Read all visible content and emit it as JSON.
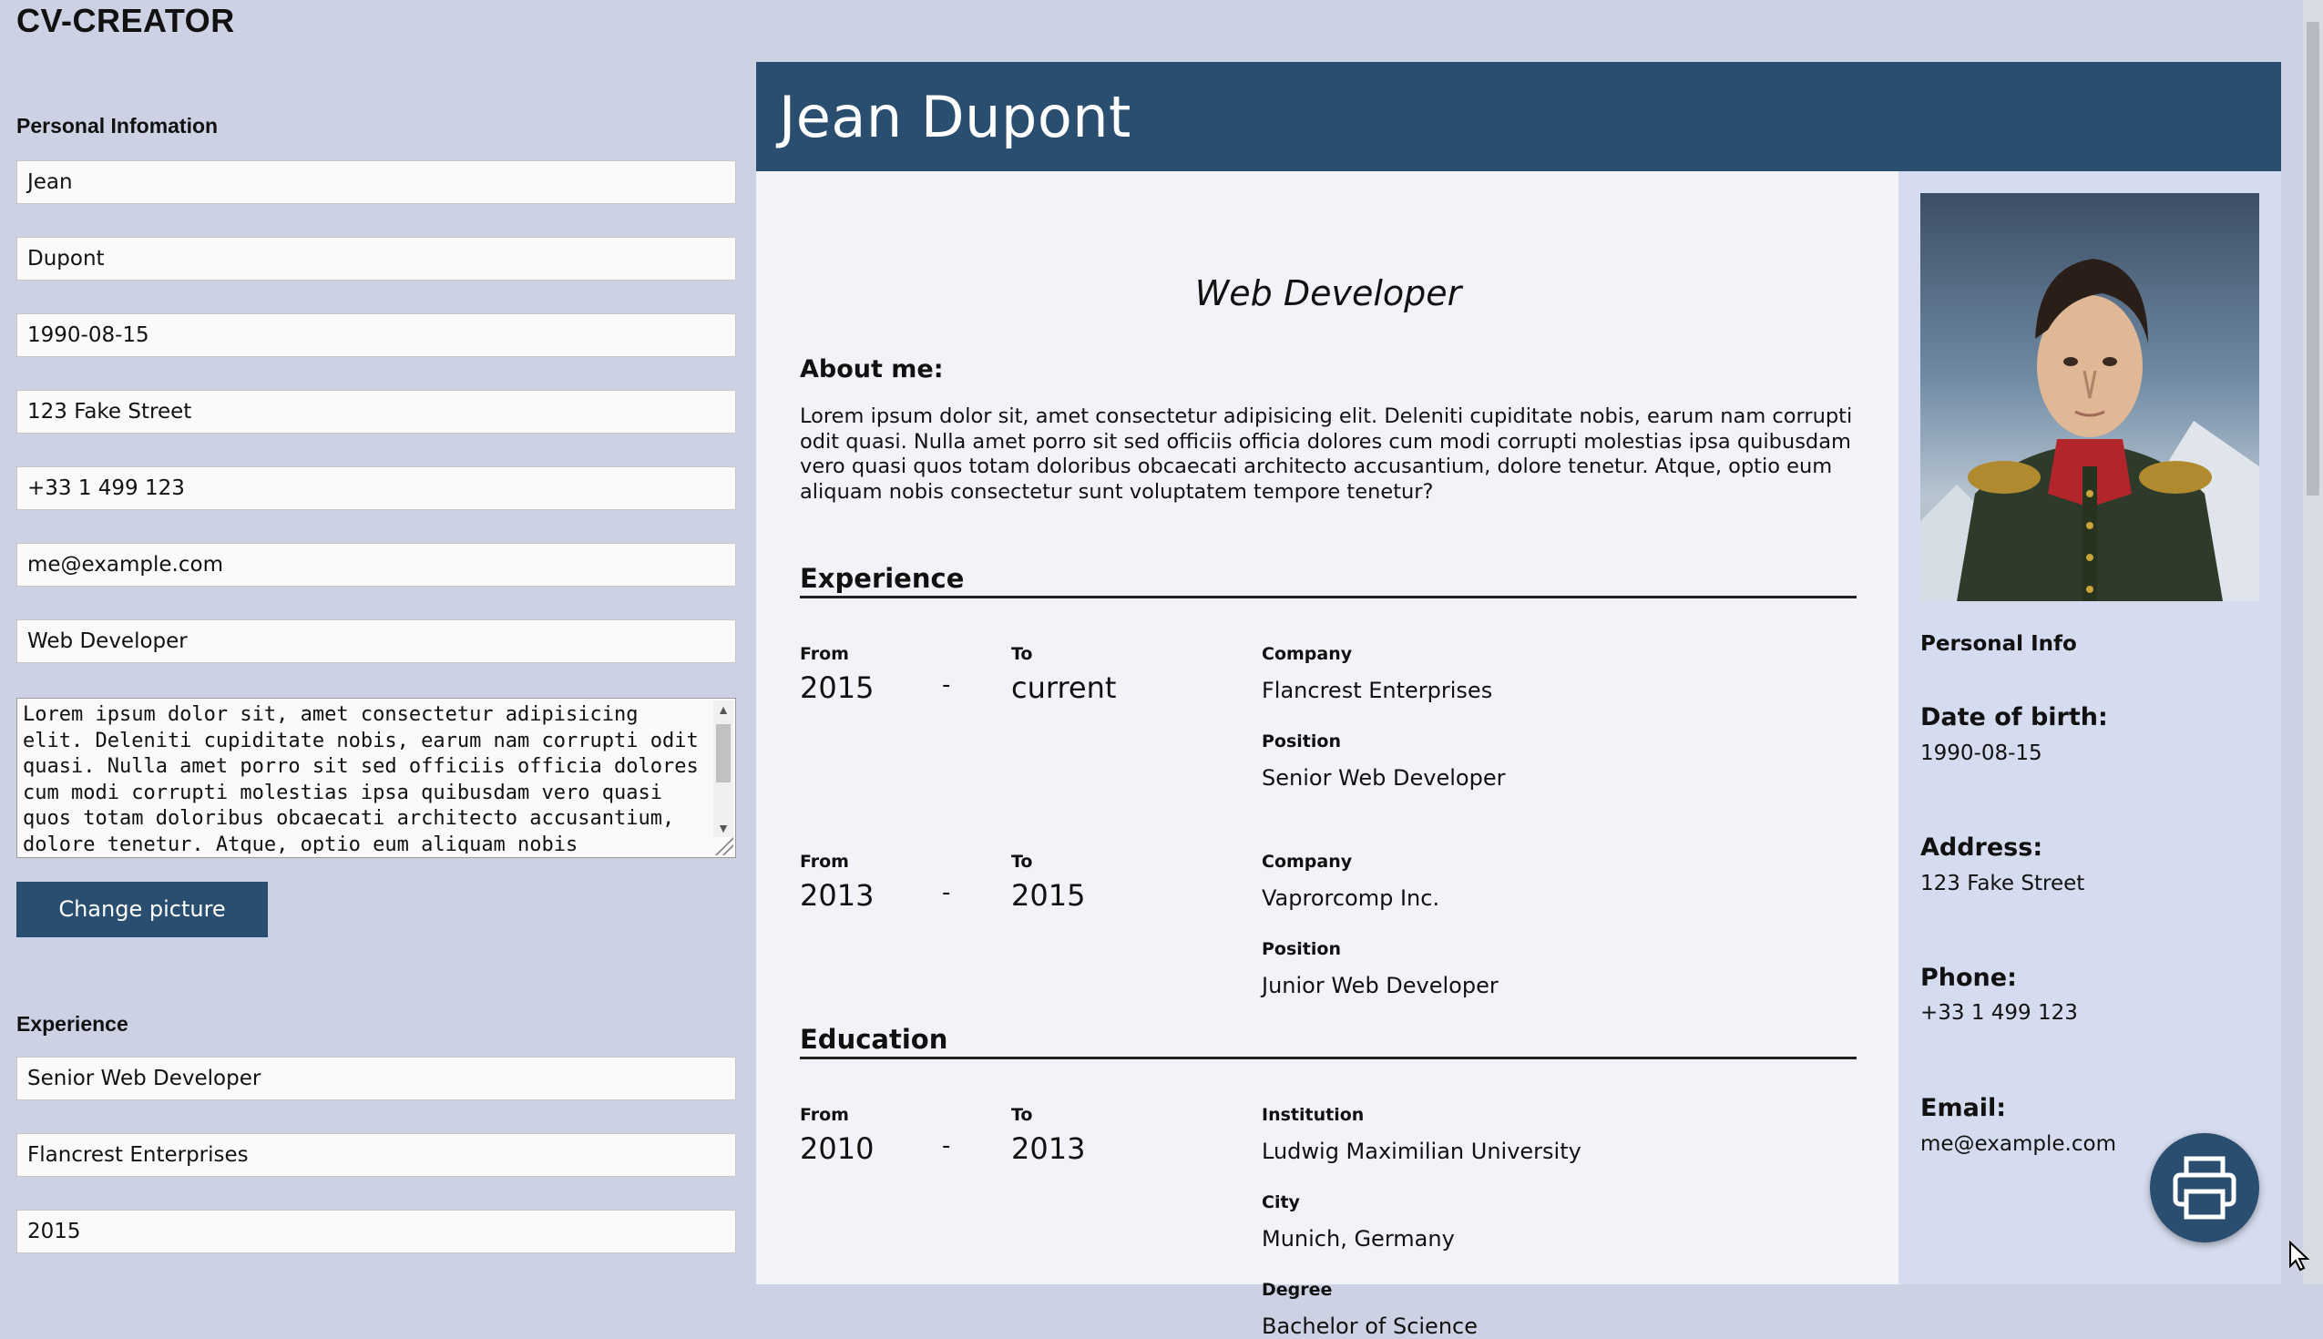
{
  "app": {
    "title": "CV-CREATOR"
  },
  "form": {
    "personal_heading": "Personal Infomation",
    "first_name": "Jean",
    "last_name": "Dupont",
    "birth_date": "1990-08-15",
    "address": "123 Fake Street",
    "phone": "+33 1 499 123",
    "email": "me@example.com",
    "job_title": "Web Developer",
    "about": "Lorem ipsum dolor sit, amet consectetur adipisicing elit. Deleniti cupiditate nobis, earum nam corrupti odit quasi. Nulla amet porro sit sed officiis officia dolores cum modi corrupti molestias ipsa quibusdam vero quasi quos totam doloribus obcaecati architecto accusantium, dolore tenetur. Atque, optio eum aliquam nobis",
    "change_picture_label": "Change picture",
    "experience_heading": "Experience",
    "exp_position": "Senior Web Developer",
    "exp_company": "Flancrest Enterprises",
    "exp_from": "2015"
  },
  "cv": {
    "name": "Jean Dupont",
    "job_title": "Web Developer",
    "about_heading": "About me:",
    "about_text": "Lorem ipsum dolor sit, amet consectetur adipisicing elit. Deleniti cupiditate nobis, earum nam corrupti odit quasi. Nulla amet porro sit sed officiis officia dolores cum modi corrupti molestias ipsa quibusdam vero quasi quos totam doloribus obcaecati architecto accusantium, dolore tenetur. Atque, optio eum aliquam nobis consectetur sunt voluptatem tempore tenetur?",
    "experience_heading": "Experience",
    "education_heading": "Education",
    "labels": {
      "from": "From",
      "to": "To",
      "dash": "-",
      "company": "Company",
      "position": "Position",
      "institution": "Institution",
      "city": "City",
      "degree": "Degree"
    },
    "experience": [
      {
        "from": "2015",
        "to": "current",
        "company": "Flancrest Enterprises",
        "position": "Senior Web Developer"
      },
      {
        "from": "2013",
        "to": "2015",
        "company": "Vaprorcomp Inc.",
        "position": "Junior Web Developer"
      }
    ],
    "education": [
      {
        "from": "2010",
        "to": "2013",
        "institution": "Ludwig Maximilian University",
        "city": "Munich, Germany",
        "degree": "Bachelor of Science"
      }
    ],
    "side": {
      "heading": "Personal Info",
      "dob_label": "Date of birth:",
      "dob": "1990-08-15",
      "address_label": "Address:",
      "address": "123 Fake Street",
      "phone_label": "Phone:",
      "phone": "+33 1 499 123",
      "email_label": "Email:",
      "email": "me@example.com"
    }
  },
  "colors": {
    "page_bg": "#cdd1e4",
    "accent": "#294e70",
    "cv_bg": "#f2f3f8",
    "side_bg": "#d6dcef"
  },
  "icons": {
    "print": "printer-icon",
    "photo": "portrait-photo"
  }
}
